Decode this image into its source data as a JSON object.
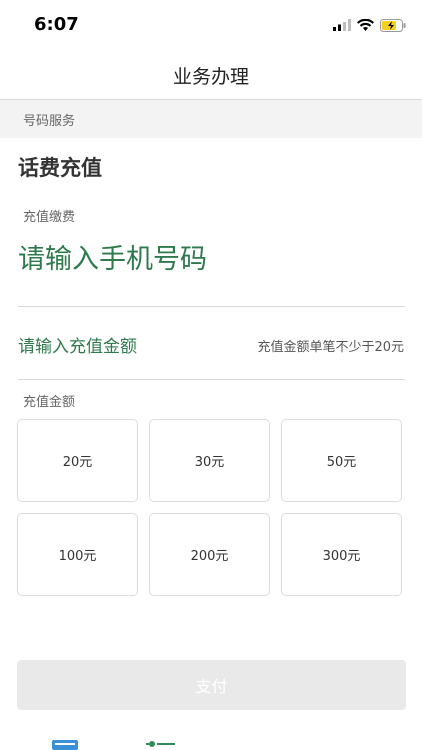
{
  "status_bar": {
    "time": "6:07"
  },
  "nav": {
    "title": "业务办理"
  },
  "section": {
    "header": "号码服务"
  },
  "card": {
    "title": "话费充值",
    "phone_label": "充值缴费",
    "phone_placeholder": "请输入手机号码",
    "amount_input_label": "请输入充值金额",
    "amount_hint": "充值金额单笔不少于20元",
    "amounts_label": "充值金额",
    "amounts": [
      "20元",
      "30元",
      "50元",
      "100元",
      "200元",
      "300元"
    ]
  },
  "pay_button": {
    "label": "支付"
  },
  "colors": {
    "accent_green": "#2f7a4c",
    "tab_blue": "#3a8fd6",
    "tab_green": "#2f8a5a",
    "battery_yellow": "#f5d020"
  },
  "icons": [
    "signal-icon",
    "wifi-icon",
    "battery-icon",
    "tab-document-icon",
    "tab-list-icon"
  ]
}
